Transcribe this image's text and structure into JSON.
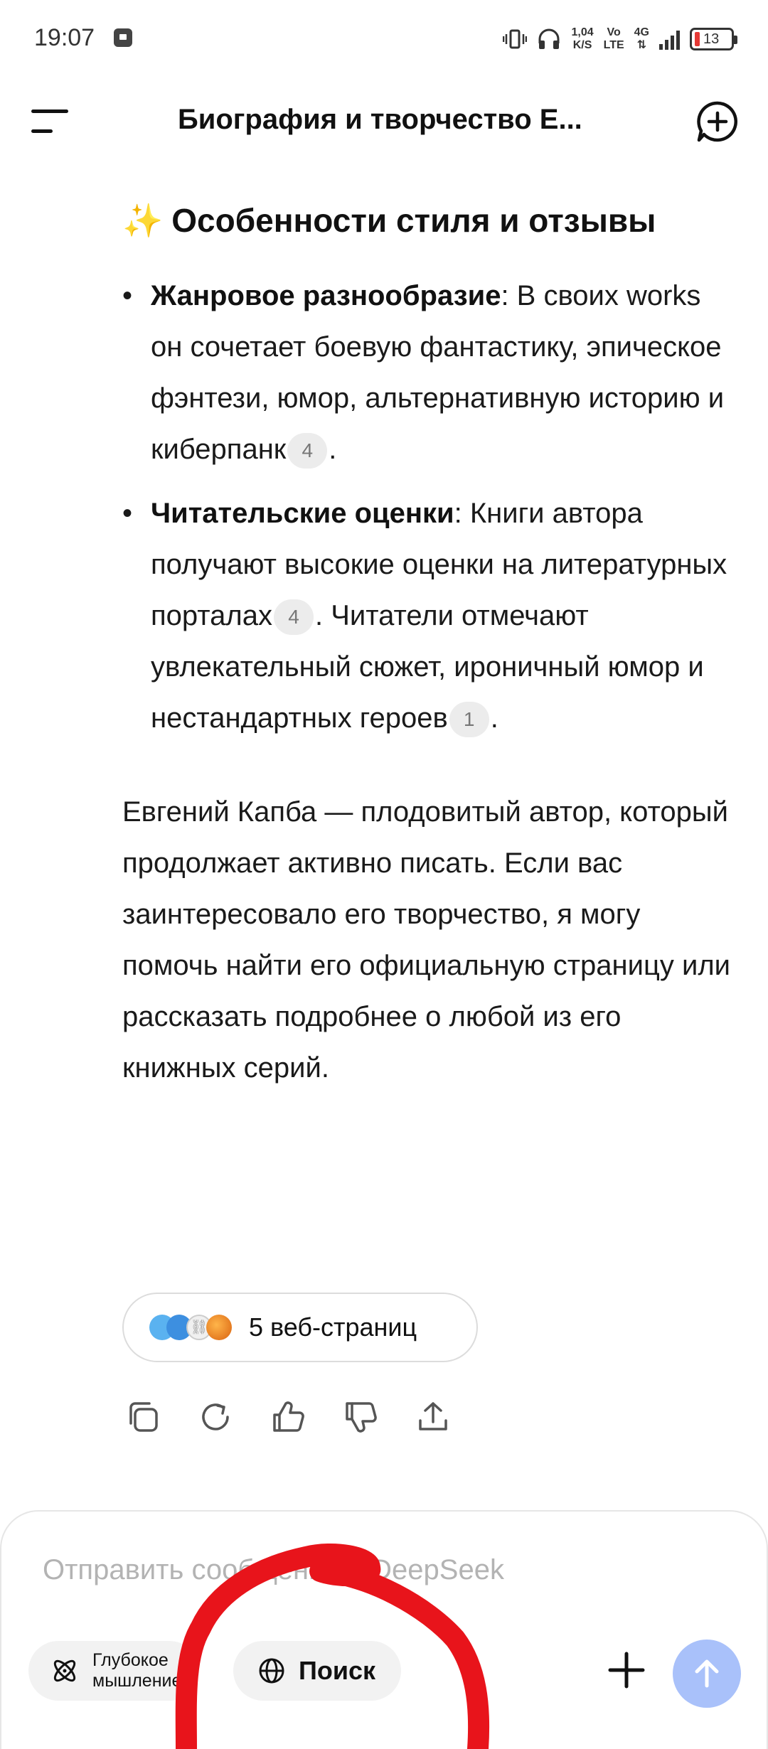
{
  "status_bar": {
    "time": "19:07",
    "net_speed_value": "1,04",
    "net_speed_unit": "K/S",
    "net_type_top": "Vo",
    "net_type_bottom": "LTE",
    "net_gen": "4G",
    "battery_level": "13",
    "icons": [
      "app-notification-icon",
      "vibrate-icon",
      "headphones-icon",
      "signal-icon",
      "battery-icon"
    ]
  },
  "header": {
    "title": "Биография и творчество Е...",
    "menu_icon": "menu-icon",
    "new_chat_icon": "new-chat-icon"
  },
  "message": {
    "section_heading": "Особенности стиля и отзывы",
    "section_emoji": "✨",
    "bullets": [
      {
        "bold": "Жанровое разнообразие",
        "text": ": В своих works он сочетает боевую фантастику, эпическое фэнтези, юмор, альтернативную историю и киберпанк",
        "cite": "4",
        "end": "."
      },
      {
        "bold": "Читательские оценки",
        "text": ": Книги автора получают высокие оценки на литературных порталах",
        "cite": "4",
        "text2": ". Читатели отмечают увлекательный сюжет, ироничный юмор и нестандартных героев",
        "cite2": "1",
        "end": "."
      }
    ],
    "closing_paragraph": "Евгений Капба — плодовитый автор, который продолжает активно писать. Если вас заинтересовало его творчество, я могу помочь найти его официальную страницу или рассказать подробнее о любой из его книжных серий."
  },
  "sources": {
    "label": "5 веб-страниц"
  },
  "actions": [
    "copy-icon",
    "regenerate-icon",
    "like-icon",
    "dislike-icon",
    "share-icon"
  ],
  "composer": {
    "placeholder": "Отправить сообщение в DeepSeek",
    "deep_think_label": "Глубокое\nмышление",
    "search_label": "Поиск"
  },
  "colors": {
    "accent_send": "#a9c1fa",
    "scribble": "#e8141b",
    "chip_bg": "#f2f2f2"
  }
}
